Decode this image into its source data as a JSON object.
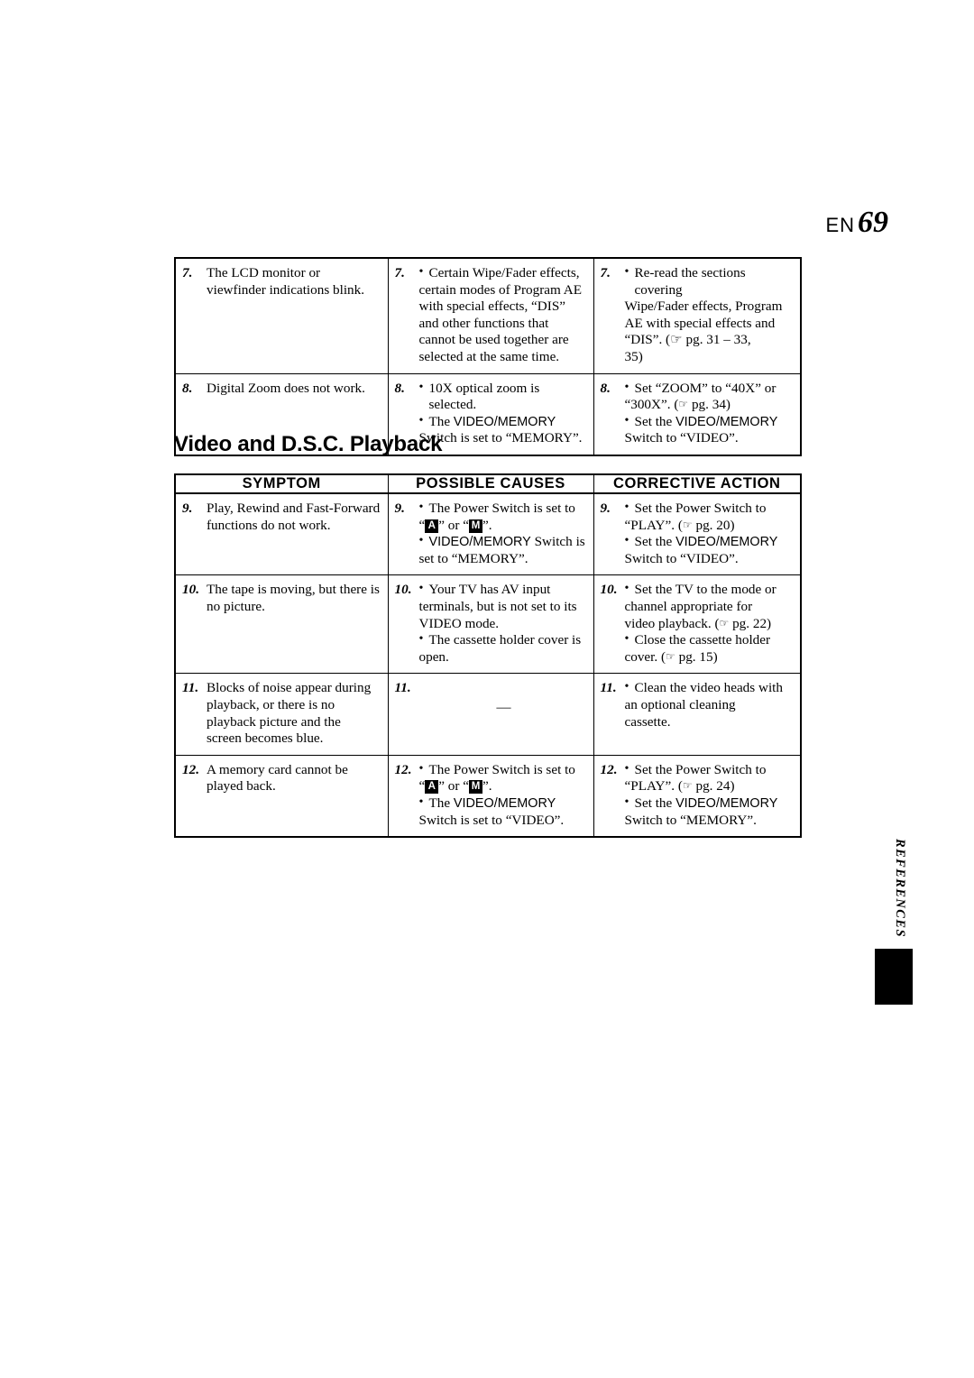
{
  "header": {
    "en_label": "EN",
    "page_number": "69"
  },
  "section_title": "Video and D.S.C. Playback",
  "side_tab": "REFERENCES",
  "table_top": {
    "rows": [
      {
        "num": "7.",
        "symptom": [
          "The LCD monitor or",
          "viewfinder indications blink."
        ],
        "cause_num": "7.",
        "causes": [
          "Certain Wipe/Fader effects,",
          "certain modes of Program AE",
          "with special effects, “DIS”",
          "and other functions that",
          "cannot be used together are",
          "selected at the same time."
        ],
        "action_num": "7.",
        "actions": [
          "Re-read the sections covering",
          "Wipe/Fader effects, Program",
          "AE with special effects and",
          "“DIS”. (☞ pg. 31 – 33,",
          "35)"
        ]
      },
      {
        "num": "8.",
        "symptom": [
          "Digital Zoom does not work."
        ],
        "cause_num": "8.",
        "causes": [
          "10X optical zoom is selected.",
          "The VIDEO/MEMORY",
          "Switch is set to “MEMORY”."
        ],
        "action_num": "8.",
        "actions": [
          "Set “ZOOM” to “40X” or",
          "“300X”. (☞ pg. 34)",
          "Set the VIDEO/MEMORY",
          "Switch to “VIDEO”."
        ]
      }
    ]
  },
  "table_main": {
    "headers": [
      "SYMPTOM",
      "POSSIBLE CAUSES",
      "CORRECTIVE ACTION"
    ],
    "rows": [
      {
        "num": "9.",
        "symptom": [
          "Play, Rewind and Fast-Forward",
          "functions do not work."
        ],
        "cause_num": "9.",
        "causes": [
          "The Power Switch is set to",
          "“A” or “M”.",
          "VIDEO/MEMORY Switch is",
          "set to “MEMORY”."
        ],
        "action_num": "9.",
        "actions": [
          "Set the Power Switch to",
          "“PLAY”. (☞ pg. 20)",
          "Set the VIDEO/MEMORY",
          "Switch to “VIDEO”."
        ]
      },
      {
        "num": "10.",
        "symptom": [
          "The tape is moving, but there is",
          "no picture."
        ],
        "cause_num": "10.",
        "causes": [
          "Your TV has AV input",
          "terminals, but is not set to its",
          "VIDEO mode.",
          "The cassette holder cover is",
          "open."
        ],
        "action_num": "10.",
        "actions": [
          "Set the TV to the mode or",
          "channel appropriate for",
          "video playback. (☞ pg. 22)",
          "Close the cassette holder",
          "cover. (☞ pg. 15)"
        ]
      },
      {
        "num": "11.",
        "symptom": [
          "Blocks of noise appear during",
          "playback, or there is no",
          "playback picture and the",
          "screen becomes blue."
        ],
        "cause_num": "11.",
        "causes": [
          "—"
        ],
        "action_num": "11.",
        "actions": [
          "Clean the video heads with",
          "an optional cleaning",
          "cassette."
        ]
      },
      {
        "num": "12.",
        "symptom": [
          "A memory card cannot be",
          "played back."
        ],
        "cause_num": "12.",
        "causes": [
          "The Power Switch is set to",
          "“A” or “M”.",
          "The VIDEO/MEMORY",
          "Switch is set to “VIDEO”."
        ],
        "action_num": "12.",
        "actions": [
          "Set the Power Switch to",
          "“PLAY”. (☞ pg. 24)",
          "Set the VIDEO/MEMORY",
          "Switch to “MEMORY”."
        ]
      }
    ]
  }
}
